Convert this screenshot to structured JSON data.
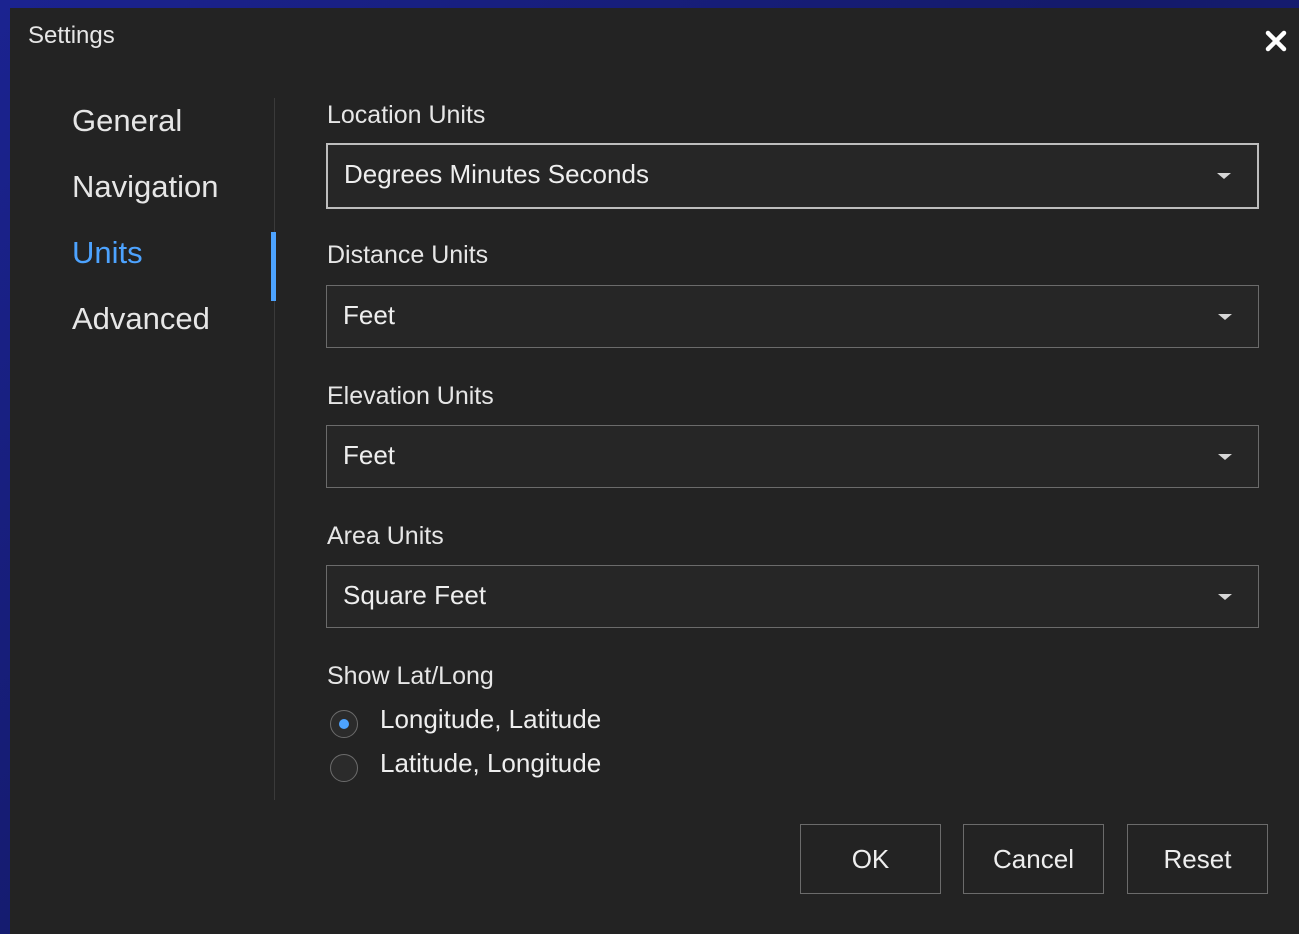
{
  "dialog": {
    "title": "Settings",
    "close_icon": "close-icon"
  },
  "sidebar": {
    "items": [
      {
        "label": "General",
        "active": false
      },
      {
        "label": "Navigation",
        "active": false
      },
      {
        "label": "Units",
        "active": true
      },
      {
        "label": "Advanced",
        "active": false
      }
    ]
  },
  "units": {
    "location": {
      "label": "Location Units",
      "value": "Degrees Minutes Seconds"
    },
    "distance": {
      "label": "Distance Units",
      "value": "Feet"
    },
    "elevation": {
      "label": "Elevation Units",
      "value": "Feet"
    },
    "area": {
      "label": "Area Units",
      "value": "Square Feet"
    },
    "latlong": {
      "label": "Show Lat/Long",
      "options": [
        {
          "label": "Longitude, Latitude",
          "checked": true
        },
        {
          "label": "Latitude, Longitude",
          "checked": false
        }
      ]
    }
  },
  "buttons": {
    "ok": "OK",
    "cancel": "Cancel",
    "reset": "Reset"
  },
  "colors": {
    "accent": "#4da3ff",
    "background": "#232323",
    "border": "#6b6b6b"
  }
}
